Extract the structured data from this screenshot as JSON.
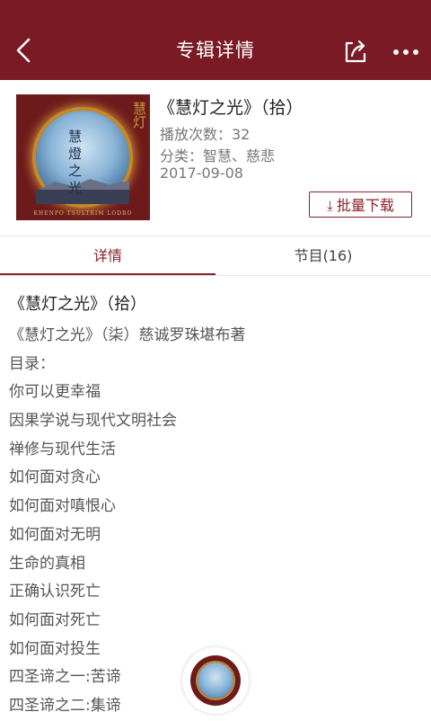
{
  "header": {
    "title": "专辑详情"
  },
  "album": {
    "title": "《慧灯之光》（拾）",
    "play_count": "播放次数：32",
    "category": "分类：智慧、慈悲",
    "date": "2017-09-08",
    "download_label": "批量下载",
    "cover": {
      "calligraphy": "慧灯",
      "big_title": "慧燈之光",
      "caption": "KHENPO TSULTRIM LODRO"
    }
  },
  "tabs": [
    {
      "label": "详情"
    },
    {
      "label": "节目(16)"
    }
  ],
  "detail": {
    "heading": "《慧灯之光》（拾）",
    "lines": [
      "《慧灯之光》（柒）慈诚罗珠堪布著",
      "目录：",
      "你可以更幸福",
      "因果学说与现代文明社会",
      "禅修与现代生活",
      "如何面对贪心",
      "如何面对嗔恨心",
      "如何面对无明",
      "生命的真相",
      "正确认识死亡",
      "如何面对死亡",
      "如何面对投生",
      "四圣谛之一:苦谛",
      "四圣谛之二:集谛"
    ]
  },
  "colors": {
    "brand": "#7a1a24",
    "accent": "#8a1f2a"
  },
  "icons": {
    "back": "back-icon",
    "share": "share-icon",
    "more": "more-icon",
    "download": "download-icon"
  }
}
